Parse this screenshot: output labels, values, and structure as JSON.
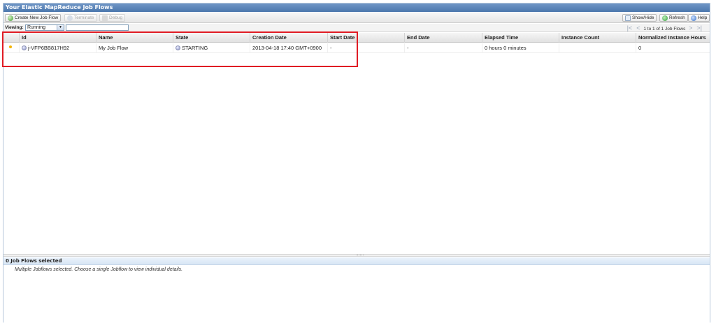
{
  "panel": {
    "title": "Your Elastic MapReduce Job Flows"
  },
  "toolbar": {
    "create_label": "Create New Job Flow",
    "terminate_label": "Terminate",
    "debug_label": "Debug",
    "show_hide_label": "Show/Hide",
    "refresh_label": "Refresh",
    "help_label": "Help"
  },
  "viewbar": {
    "viewing_label": "Viewing:",
    "selected_filter": "Running",
    "pager_text": "1 to 1 of 1 Job Flows"
  },
  "table": {
    "columns": [
      "Id",
      "Name",
      "State",
      "Creation Date",
      "Start Date",
      "End Date",
      "Elapsed Time",
      "Instance Count",
      "Normalized Instance Hours"
    ],
    "rows": [
      {
        "id": "j-VFP6BB817H92",
        "name": "My Job Flow",
        "state": "STARTING",
        "creation_date": "2013-04-18 17:40 GMT+0900",
        "start_date": "-",
        "end_date": "-",
        "elapsed_time": "0 hours 0 minutes",
        "instance_count": "",
        "normalized_hours": "0"
      }
    ]
  },
  "details": {
    "header": "0 Job Flows selected",
    "message": "Multiple Jobflows selected. Choose a single Jobflow to view individual details."
  },
  "colors": {
    "highlight": "#e01b24",
    "titlebar": "#4b77ad"
  }
}
